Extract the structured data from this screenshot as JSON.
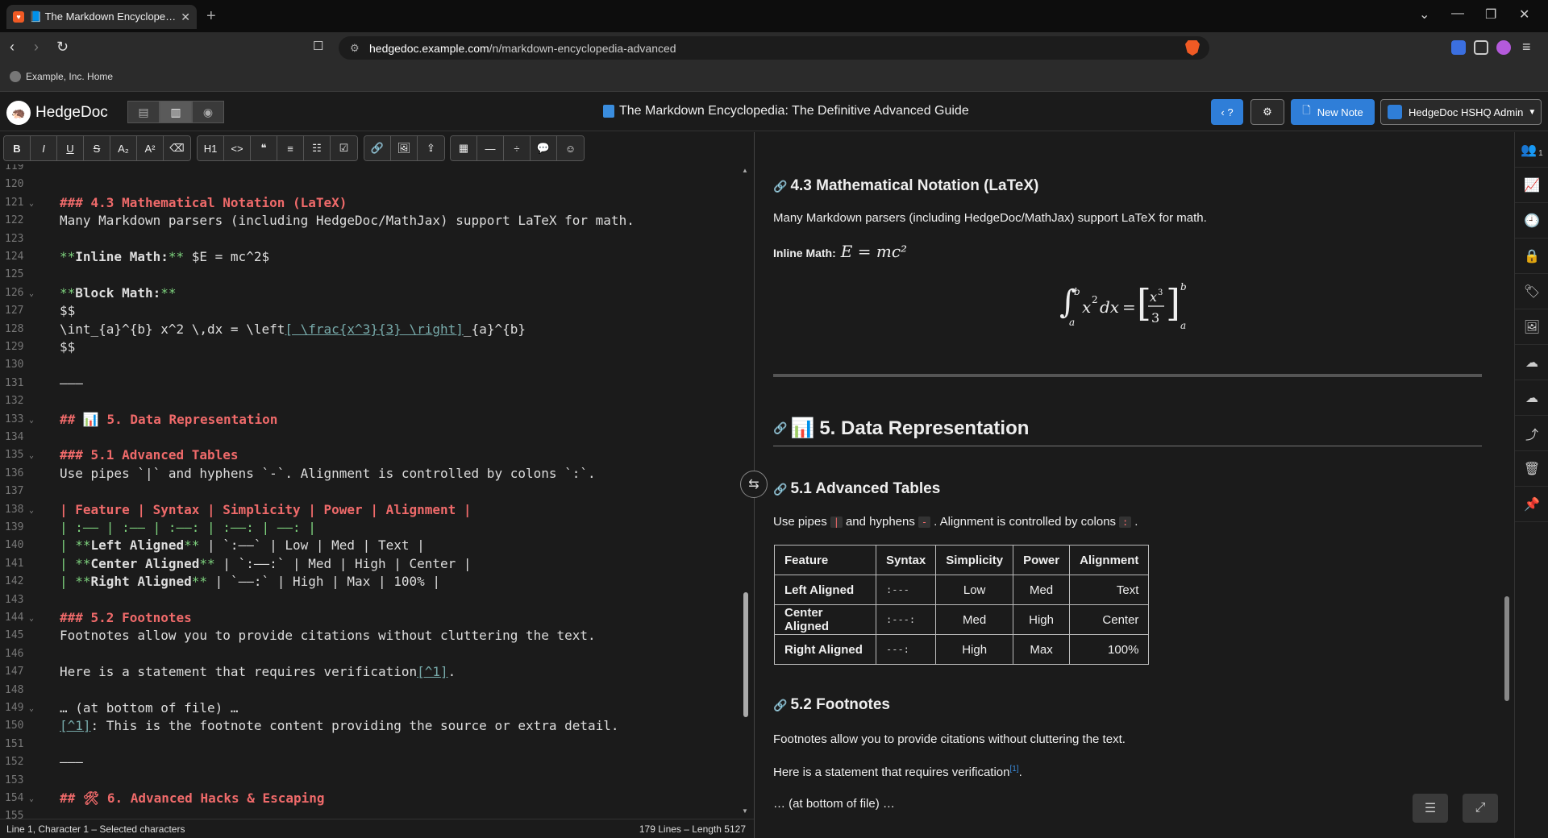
{
  "browser": {
    "tab_title": "📘 The Markdown Encyclopedia",
    "url_host": "hedgedoc.example.com",
    "url_path": "/n/markdown-encyclopedia-advanced",
    "bookmark": "Example, Inc. Home"
  },
  "header": {
    "app_name": "HedgeDoc",
    "note_title": "The Markdown Encyclopedia: The Definitive Advanced Guide",
    "help_label": "‹ ?",
    "new_note_label": "New Note",
    "user_label": "HedgeDoc HSHQ Admin"
  },
  "toolbar": {
    "buttons": [
      "B",
      "I",
      "U",
      "S",
      "A₂",
      "A²",
      "⌫",
      "H1",
      "<>",
      "❝",
      "≡",
      "☷",
      "☑",
      "🔗",
      "🖼",
      "⇪",
      "▦",
      "—",
      "÷",
      "💬",
      "☺"
    ]
  },
  "editor": {
    "lines": [
      {
        "n": "119",
        "fold": false,
        "html": ""
      },
      {
        "n": "120",
        "fold": false,
        "html": ""
      },
      {
        "n": "121",
        "fold": true,
        "html": "<span class='h'>### 4.3 Mathematical Notation (LaTeX)</span>"
      },
      {
        "n": "122",
        "fold": false,
        "html": "Many Markdown parsers (including HedgeDoc/MathJax) support LaTeX for math."
      },
      {
        "n": "123",
        "fold": false,
        "html": ""
      },
      {
        "n": "124",
        "fold": false,
        "html": "<span class='g'>**</span><b>Inline Math:</b><span class='g'>**</span> $E = mc^2$"
      },
      {
        "n": "125",
        "fold": false,
        "html": ""
      },
      {
        "n": "126",
        "fold": true,
        "html": "<span class='g'>**</span><b>Block Math:</b><span class='g'>**</span>"
      },
      {
        "n": "127",
        "fold": false,
        "html": "$$"
      },
      {
        "n": "128",
        "fold": false,
        "html": "\\int_{a}^{b} x^2 \\,dx = \\left<span class='ul'>[ \\frac{x^3}{3} \\right]</span>_{a}^{b}"
      },
      {
        "n": "129",
        "fold": false,
        "html": "$$"
      },
      {
        "n": "130",
        "fold": false,
        "html": ""
      },
      {
        "n": "131",
        "fold": false,
        "html": "———"
      },
      {
        "n": "132",
        "fold": false,
        "html": ""
      },
      {
        "n": "133",
        "fold": true,
        "html": "<span class='h'>## 📊 5. Data Representation</span>"
      },
      {
        "n": "134",
        "fold": false,
        "html": ""
      },
      {
        "n": "135",
        "fold": true,
        "html": "<span class='h'>### 5.1 Advanced Tables</span>"
      },
      {
        "n": "136",
        "fold": false,
        "html": "Use pipes `|` and hyphens `-`. Alignment is controlled by colons `:`."
      },
      {
        "n": "137",
        "fold": false,
        "html": ""
      },
      {
        "n": "138",
        "fold": true,
        "html": "<span class='h'>| Feature | Syntax | Simplicity | Power | Alignment |</span>"
      },
      {
        "n": "139",
        "fold": false,
        "html": "<span class='g'>| :—— | :—— | :——: | :——: | ——: |</span>"
      },
      {
        "n": "140",
        "fold": false,
        "html": "<span class='g'>| **</span><b>Left Aligned</b><span class='g'>**</span> | `:——` | Low | Med | Text |"
      },
      {
        "n": "141",
        "fold": false,
        "html": "<span class='g'>| **</span><b>Center Aligned</b><span class='g'>**</span> | `:——:` | Med | High | Center |"
      },
      {
        "n": "142",
        "fold": false,
        "html": "<span class='g'>| **</span><b>Right Aligned</b><span class='g'>**</span> | `——:` | High | Max | 100% |"
      },
      {
        "n": "143",
        "fold": false,
        "html": ""
      },
      {
        "n": "144",
        "fold": true,
        "html": "<span class='h'>### 5.2 Footnotes</span>"
      },
      {
        "n": "145",
        "fold": false,
        "html": "Footnotes allow you to provide citations without cluttering the text."
      },
      {
        "n": "146",
        "fold": false,
        "html": ""
      },
      {
        "n": "147",
        "fold": false,
        "html": "Here is a statement that requires verification<span class='ul'>[^1]</span>."
      },
      {
        "n": "148",
        "fold": false,
        "html": ""
      },
      {
        "n": "149",
        "fold": true,
        "html": "… (at bottom of file) …"
      },
      {
        "n": "150",
        "fold": false,
        "html": "<span class='ul'>[^1]</span>: This is the footnote content providing the source or extra detail."
      },
      {
        "n": "151",
        "fold": false,
        "html": ""
      },
      {
        "n": "152",
        "fold": false,
        "html": "———"
      },
      {
        "n": "153",
        "fold": false,
        "html": ""
      },
      {
        "n": "154",
        "fold": true,
        "html": "<span class='h'>## 🛠 6. Advanced Hacks &amp; Escaping</span>"
      },
      {
        "n": "155",
        "fold": false,
        "html": ""
      }
    ]
  },
  "status": {
    "left": "Line 1, Character 1 – Selected characters",
    "right": "179 Lines – Length 5127"
  },
  "preview": {
    "h43": "4.3 Mathematical Notation (LaTeX)",
    "p43": "Many Markdown parsers (including HedgeDoc/MathJax) support LaTeX for math.",
    "inline_label": "Inline Math:",
    "inline_math": "E = mc²",
    "h5": "5. Data Representation",
    "h5_icon": "📊",
    "h51": "5.1 Advanced Tables",
    "p51_a": "Use pipes",
    "p51_pipe": "|",
    "p51_b": "and hyphens",
    "p51_dash": "-",
    "p51_c": ". Alignment is controlled by colons",
    "p51_colon": ":",
    "p51_d": ".",
    "table": {
      "headers": [
        "Feature",
        "Syntax",
        "Simplicity",
        "Power",
        "Alignment"
      ],
      "rows": [
        [
          "Left Aligned",
          ":---",
          "Low",
          "Med",
          "Text"
        ],
        [
          "Center Aligned",
          ":---:",
          "Med",
          "High",
          "Center"
        ],
        [
          "Right Aligned",
          "---:",
          "High",
          "Max",
          "100%"
        ]
      ]
    },
    "h52": "5.2 Footnotes",
    "p52": "Footnotes allow you to provide citations without cluttering the text.",
    "p52b": "Here is a statement that requires verification",
    "fn_ref": "[1]",
    "p52c": "… (at bottom of file) …"
  },
  "sidebar": {
    "icons": [
      "users-icon",
      "chart-icon",
      "history-icon",
      "lock-icon",
      "tag-icon",
      "media-icon",
      "upload-icon",
      "download-icon",
      "share-icon",
      "trash-icon",
      "pin-icon"
    ],
    "glyphs": [
      "👥",
      "📈",
      "🕘",
      "🔒",
      "🏷",
      "🖼",
      "☁",
      "☁",
      "⤴",
      "🗑",
      "📌"
    ],
    "users_count": "1"
  },
  "colors": {
    "accent": "#2f7ed8",
    "heading_red": "#ef6a6a",
    "markup_green": "#7ed37e"
  }
}
